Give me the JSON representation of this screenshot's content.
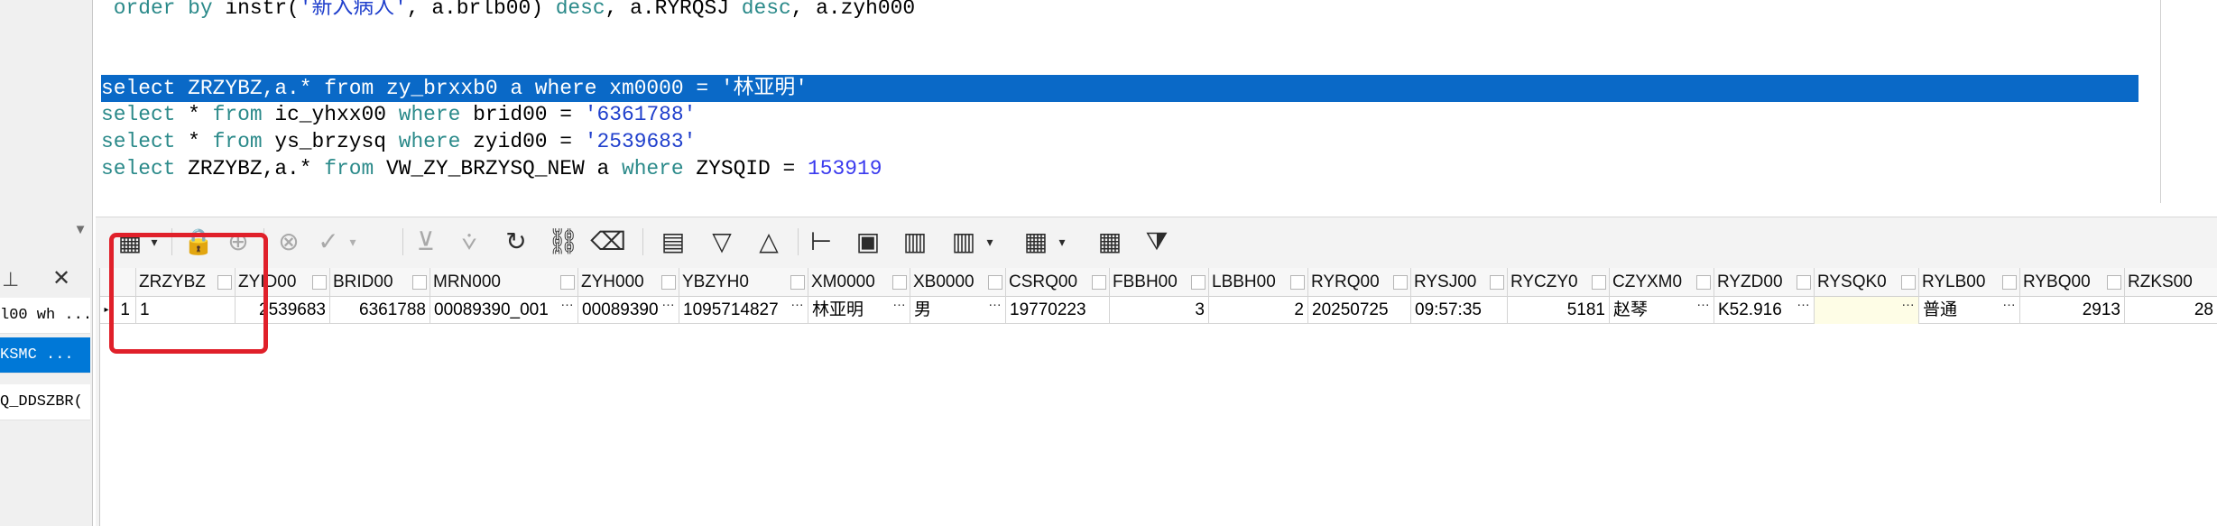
{
  "left_panel": {
    "scroll_arrow": "▼",
    "pin_glyph": "⊥",
    "close_glyph": "✕",
    "items": [
      {
        "label": "l00 wh ..."
      },
      {
        "label": "KSMC ..."
      },
      {
        "label": "Q_DDSZBR("
      }
    ]
  },
  "editor": {
    "line0": {
      "kw1": " order by ",
      "fn": "instr(",
      "str1": "'新入病人'",
      "rest1": ", a.brlb00) ",
      "kw2": "desc",
      "rest2": ", a.RYRQSJ ",
      "kw3": "desc",
      "rest3": ", a.zyh000"
    },
    "line1": {
      "kw1": "select",
      "p1": " ZRZYBZ,a.* ",
      "kw2": "from",
      "p2": " zy_brxxb0 a ",
      "kw3": "where",
      "p3": " xm0000 = ",
      "str": "'林亚明'"
    },
    "line2": {
      "kw1": "select",
      "p1": " * ",
      "kw2": "from",
      "p2": " ic_yhxx00 ",
      "kw3": "where",
      "p3": " brid00 = ",
      "str": "'6361788'"
    },
    "line3": {
      "kw1": "select",
      "p1": " * ",
      "kw2": "from",
      "p2": " ys_brzysq ",
      "kw3": "where",
      "p3": " zyid00 = ",
      "str": "'2539683'"
    },
    "line4": {
      "kw1": "select",
      "p1": " ZRZYBZ,a.* ",
      "kw2": "from",
      "p2": " VW_ZY_BRZYSQ_NEW a ",
      "kw3": "where",
      "p3": " ZYSQID = ",
      "num": "153919"
    },
    "scroll_arrow": "▼"
  },
  "toolbar": {
    "icons": {
      "grid_mode": "▦",
      "dropdown": "▾",
      "lock": "🔒",
      "add": "⊕",
      "cancel": "⊗",
      "apply": "✓",
      "nav_down": "⊻",
      "nav_last": "⩒",
      "refresh": "↻",
      "find": "⛓",
      "clear": "⌫",
      "memo": "▤",
      "sort_down": "▽",
      "sort_up": "△",
      "tree": "⊢",
      "save": "▣",
      "export": "▥",
      "chart": "▥",
      "pivot": "▦",
      "table": "▦",
      "filter": "⧩"
    }
  },
  "grid": {
    "row_indicator": "▸",
    "columns": [
      "ZRZYBZ",
      "ZYID00",
      "BRID00",
      "MRN000",
      "ZYH000",
      "YBZYH0",
      "XM0000",
      "XB0000",
      "CSRQ00",
      "FBBH00",
      "LBBH00",
      "RYRQ00",
      "RYSJ00",
      "RYCZY0",
      "CZYXM0",
      "RYZD00",
      "RYSQK0",
      "RYLB00",
      "RYBQ00",
      "RZKS00"
    ],
    "row": {
      "number": "1",
      "cells": [
        "1",
        "2539683",
        "6361788",
        "00089390_001",
        "00089390",
        "1095714827",
        "林亚明",
        "男",
        "19770223",
        "3",
        "2",
        "20250725",
        "09:57:35",
        "5181",
        "赵琴",
        "K52.916",
        "",
        "普通",
        "2913",
        "28"
      ]
    },
    "ellipsis": "…"
  },
  "colors": {
    "selection": "#0a69c7",
    "keyword": "#2b8a8a",
    "string": "#1f3fcc",
    "highlight": "#e0202a",
    "left_selected": "#0078d7"
  }
}
